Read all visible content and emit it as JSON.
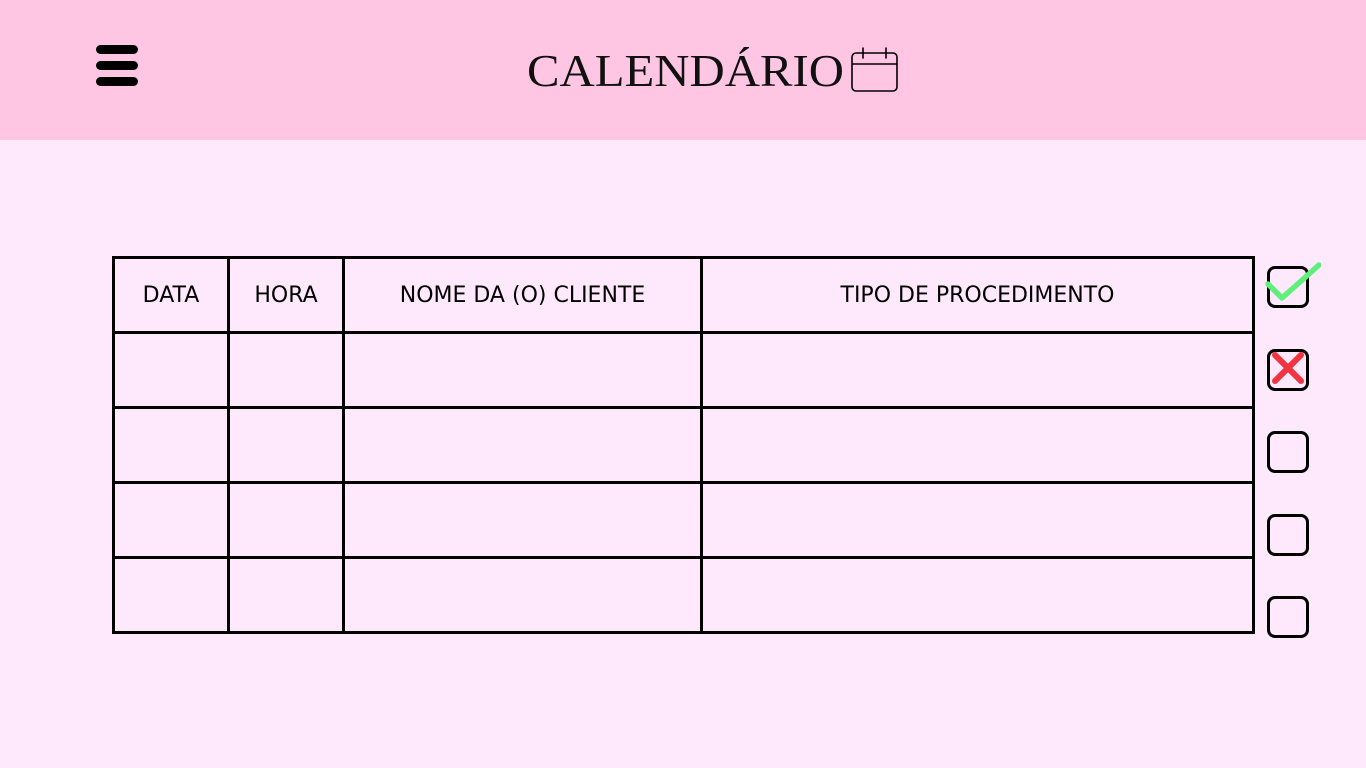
{
  "header": {
    "title": "CALENDÁRIO",
    "menu_icon": "hamburger-menu-icon",
    "title_icon": "calendar-icon",
    "background_color": "#ffc6e3"
  },
  "page": {
    "background_color": "#fde9fb"
  },
  "table": {
    "columns": [
      "DATA",
      "HORA",
      "NOME DA (O) CLIENTE",
      "TIPO DE PROCEDIMENTO"
    ],
    "rows": [
      [
        "",
        "",
        "",
        ""
      ],
      [
        "",
        "",
        "",
        ""
      ],
      [
        "",
        "",
        "",
        ""
      ],
      [
        "",
        "",
        "",
        ""
      ]
    ]
  },
  "status_checkboxes": [
    {
      "state": "checked",
      "icon": "green-check-icon",
      "color": "#5ef07a"
    },
    {
      "state": "rejected",
      "icon": "red-x-icon",
      "color": "#f2323f"
    },
    {
      "state": "empty"
    },
    {
      "state": "empty"
    },
    {
      "state": "empty"
    }
  ]
}
